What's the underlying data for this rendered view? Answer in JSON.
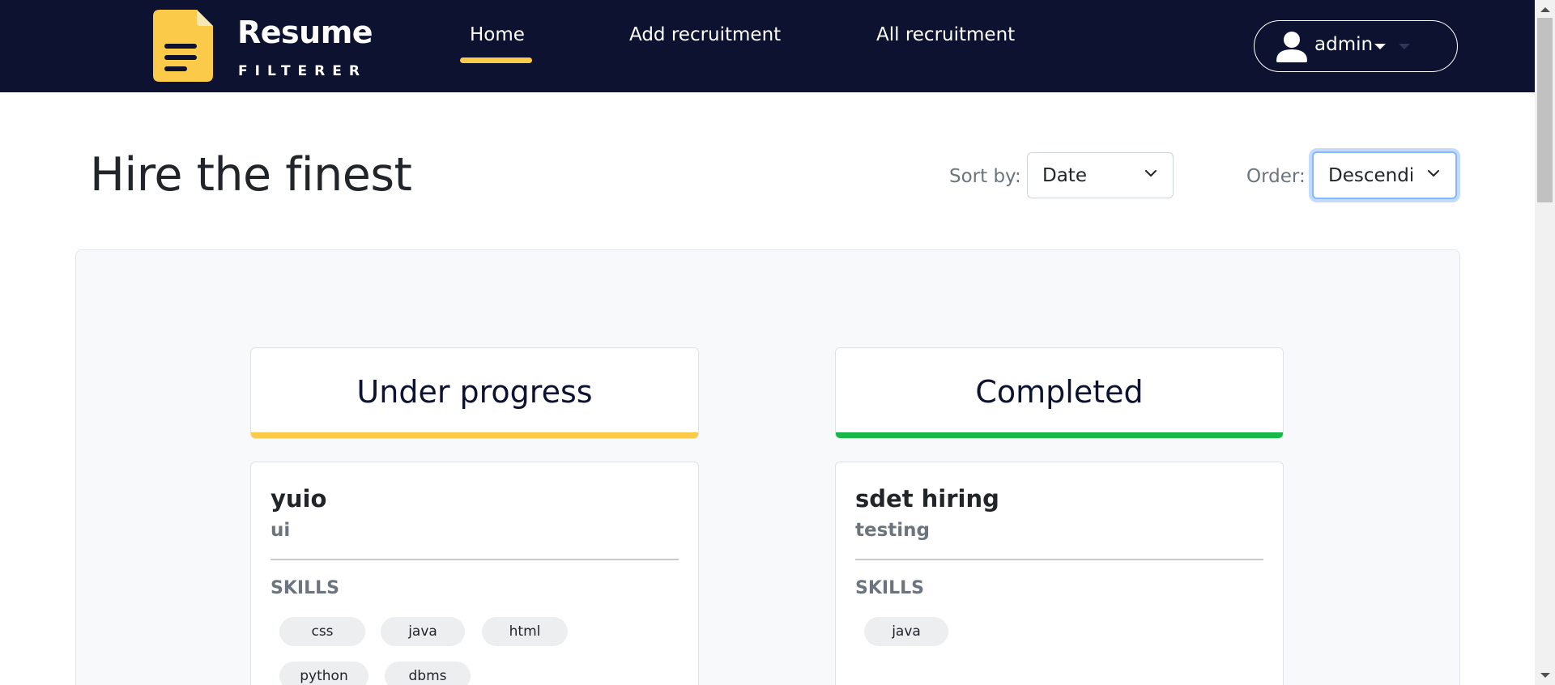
{
  "navbar": {
    "logo_title": "Resume",
    "logo_subtitle": "FILTERER",
    "links": {
      "home": "Home",
      "add_recruitment": "Add recruitment",
      "all_recruitment": "All recruitment"
    },
    "active_link": "Home",
    "user": {
      "name": "admin",
      "icon": "user-icon"
    }
  },
  "header": {
    "title": "Hire the finest",
    "sort_label": "Sort by:",
    "sort_value": "Date",
    "order_label": "Order:",
    "order_value": "Descending"
  },
  "columns": [
    {
      "title": "Under progress",
      "accent_color": "#fbca48",
      "card": {
        "title": "yuio",
        "subtitle": "ui",
        "skills_label": "SKILLS",
        "skills": [
          "css",
          "java",
          "html",
          "python",
          "dbms"
        ]
      }
    },
    {
      "title": "Completed",
      "accent_color": "#17b84a",
      "card": {
        "title": "sdet hiring",
        "subtitle": "testing",
        "skills_label": "SKILLS",
        "skills": [
          "java"
        ]
      }
    }
  ],
  "colors": {
    "navbar_bg": "#0c1230",
    "accent_yellow": "#fbca48",
    "accent_green": "#17b84a"
  }
}
